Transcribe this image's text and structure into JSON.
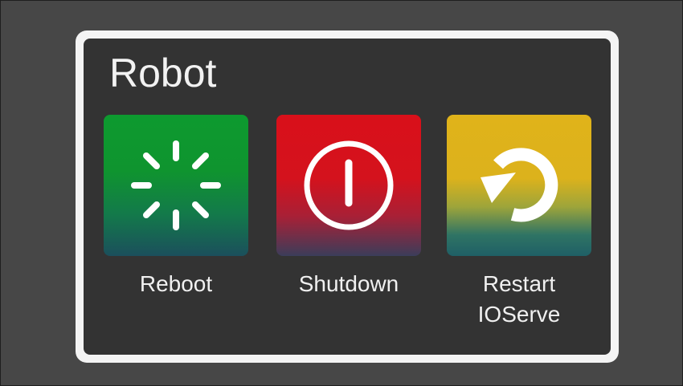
{
  "panel": {
    "title": "Robot"
  },
  "tiles": [
    {
      "id": "reboot",
      "label": "Reboot",
      "icon": "spinner-icon",
      "color": "#0d9a2f"
    },
    {
      "id": "shutdown",
      "label": "Shutdown",
      "icon": "power-icon",
      "color": "#d9101a"
    },
    {
      "id": "restart",
      "label": "Restart\nIOServe",
      "icon": "restart-arrow-icon",
      "color": "#e0b31a"
    }
  ],
  "colors": {
    "background": "#4a4a4a",
    "panel_border": "#f4f4f4",
    "panel_fill": "#333333",
    "text": "#f0f0f0"
  }
}
